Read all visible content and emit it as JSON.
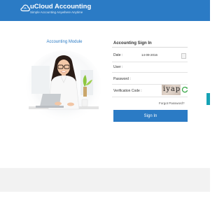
{
  "header": {
    "title": "uCloud Accounting",
    "tagline": "Simple Accounting Anywhere Anytime",
    "logo_icon": "cloud-icon",
    "background": "#2b7bc5"
  },
  "module": {
    "title": "Accounting Module"
  },
  "signin": {
    "title": "Accounting Sign In",
    "date_label": "Date :",
    "date_value": "14-09-2016",
    "user_label": "User :",
    "user_value": "",
    "password_label": "Password :",
    "password_value": "",
    "code_label": "Verification Code :",
    "code_value": "",
    "captcha_text": "iyap",
    "forgot_label": "Forgot Password?",
    "button_label": "Sign In",
    "icons": [
      "calendar-icon",
      "refresh-icon"
    ]
  },
  "colors": {
    "accent": "#2b7bc5",
    "side_tab": "#16a3b5",
    "footer": "#f2f2f2"
  }
}
